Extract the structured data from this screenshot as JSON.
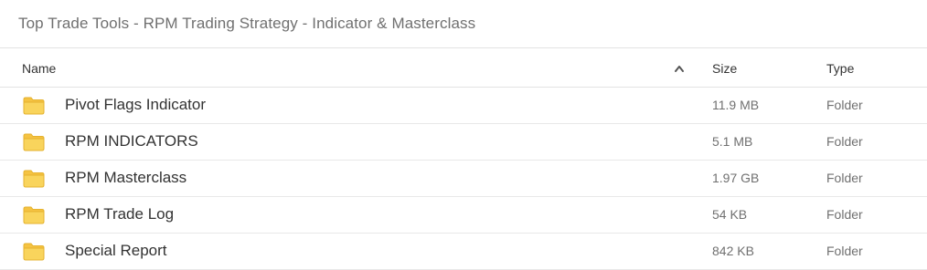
{
  "header": {
    "title": "Top Trade Tools - RPM Trading Strategy - Indicator & Masterclass"
  },
  "table": {
    "columns": {
      "name": "Name",
      "size": "Size",
      "type": "Type"
    },
    "sort_icon": "chevron-up-icon",
    "rows": [
      {
        "icon": "folder-icon",
        "name": "Pivot Flags Indicator",
        "size": "11.9 MB",
        "type": "Folder"
      },
      {
        "icon": "folder-icon",
        "name": "RPM INDICATORS",
        "size": "5.1 MB",
        "type": "Folder"
      },
      {
        "icon": "folder-icon",
        "name": "RPM Masterclass",
        "size": "1.97 GB",
        "type": "Folder"
      },
      {
        "icon": "folder-icon",
        "name": "RPM Trade Log",
        "size": "54 KB",
        "type": "Folder"
      },
      {
        "icon": "folder-icon",
        "name": "Special Report",
        "size": "842 KB",
        "type": "Folder"
      }
    ]
  },
  "colors": {
    "folder_fill": "#f9d45c",
    "folder_tab": "#f5c342",
    "folder_outline": "#e5b22e",
    "divider": "#e3e3e3",
    "muted_text": "#707070",
    "primary_text": "#333333"
  }
}
